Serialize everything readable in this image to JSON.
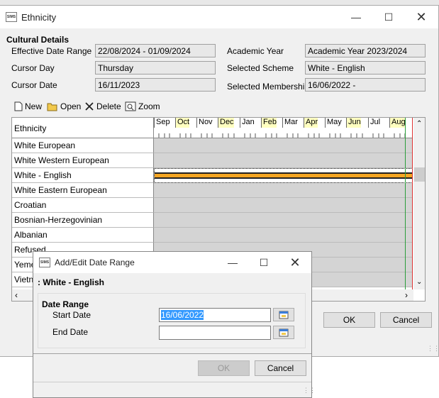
{
  "main_window": {
    "title": "Ethnicity",
    "app_icon": "SIMS",
    "section_title": "Cultural Details",
    "fields": {
      "effective_date_range_label": "Effective Date Range",
      "effective_date_range_value": "22/08/2024 - 01/09/2024",
      "cursor_day_label": "Cursor Day",
      "cursor_day_value": "Thursday",
      "cursor_date_label": "Cursor Date",
      "cursor_date_value": "16/11/2023",
      "academic_year_label": "Academic Year",
      "academic_year_value": "Academic Year 2023/2024",
      "selected_scheme_label": "Selected Scheme",
      "selected_scheme_value": "White - English",
      "selected_membership_label": "Selected Membership",
      "selected_membership_value": "16/06/2022 -"
    },
    "toolbar": {
      "new": "New",
      "open": "Open",
      "delete": "Delete",
      "zoom": "Zoom"
    },
    "grid": {
      "header": "Ethnicity",
      "months": [
        "Sep",
        "Oct",
        "Nov",
        "Dec",
        "Jan",
        "Feb",
        "Mar",
        "Apr",
        "May",
        "Jun",
        "Jul",
        "Aug"
      ],
      "rows": [
        "White European",
        "White Western European",
        "White - English",
        "White Eastern European",
        "Croatian",
        "Bosnian-Herzegovinian",
        "Albanian",
        "Refused",
        "Yeme",
        "Vietn"
      ]
    },
    "ok_label": "OK",
    "cancel_label": "Cancel"
  },
  "dialog": {
    "title": "Add/Edit Date Range",
    "app_icon": "SIMS",
    "subtitle": ": White - English",
    "group_title": "Date Range",
    "start_date_label": "Start Date",
    "start_date_value": "16/06/2022",
    "end_date_label": "End Date",
    "end_date_value": "",
    "ok_label": "OK",
    "cancel_label": "Cancel"
  },
  "colors": {
    "highlight_bar": "#f5a623",
    "selection": "#3399ff",
    "cursor_line": "#2a9d3a"
  }
}
